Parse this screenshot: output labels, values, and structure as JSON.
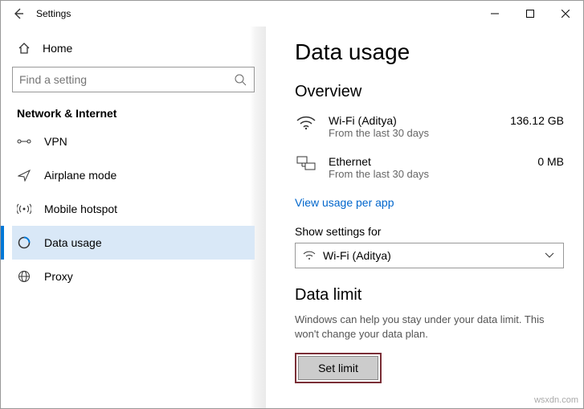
{
  "window": {
    "title": "Settings"
  },
  "sidebar": {
    "home": "Home",
    "searchPlaceholder": "Find a setting",
    "sectionHeader": "Network & Internet",
    "items": [
      {
        "label": "VPN",
        "icon": "vpn"
      },
      {
        "label": "Airplane mode",
        "icon": "airplane"
      },
      {
        "label": "Mobile hotspot",
        "icon": "hotspot"
      },
      {
        "label": "Data usage",
        "icon": "datausage",
        "active": true
      },
      {
        "label": "Proxy",
        "icon": "proxy"
      }
    ]
  },
  "main": {
    "title": "Data usage",
    "overviewHeader": "Overview",
    "overview": [
      {
        "name": "Wi-Fi (Aditya)",
        "sub": "From the last 30 days",
        "amount": "136.12 GB",
        "icon": "wifi"
      },
      {
        "name": "Ethernet",
        "sub": "From the last 30 days",
        "amount": "0 MB",
        "icon": "ethernet"
      }
    ],
    "usageLink": "View usage per app",
    "showSettingsLabel": "Show settings for",
    "dropdown": {
      "selected": "Wi-Fi (Aditya)"
    },
    "dataLimitHeader": "Data limit",
    "dataLimitDesc": "Windows can help you stay under your data limit. This won't change your data plan.",
    "setLimitButton": "Set limit"
  },
  "watermark": "wsxdn.com"
}
